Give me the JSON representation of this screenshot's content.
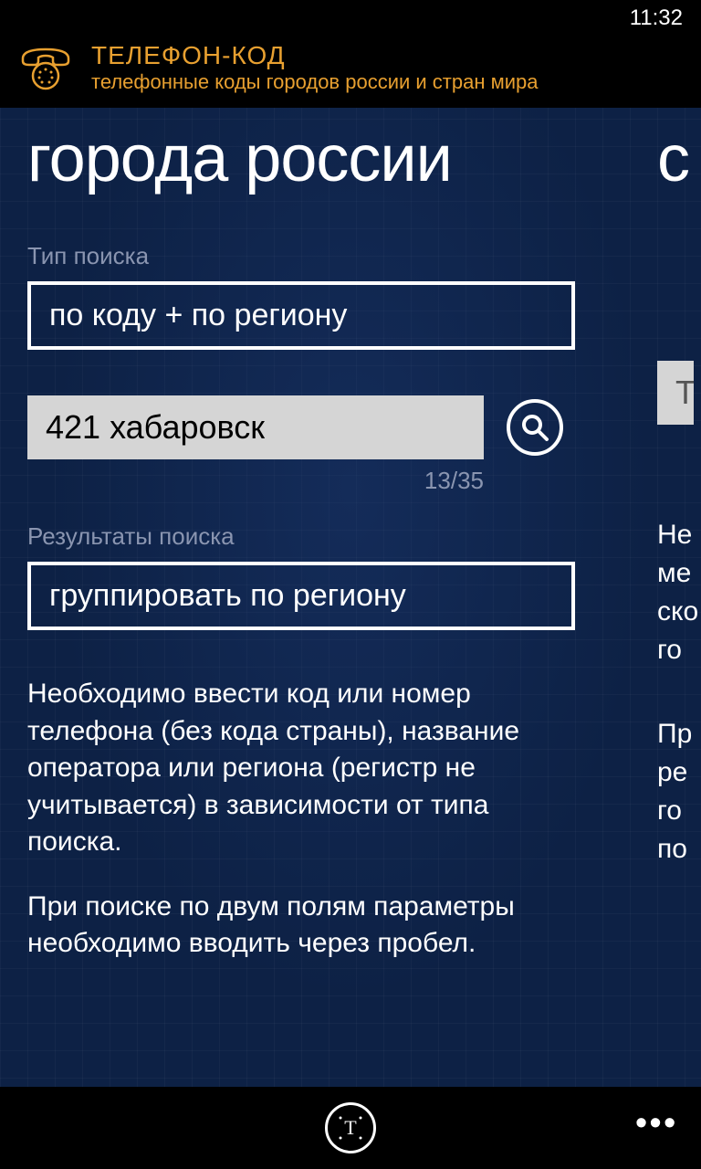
{
  "status": {
    "time": "11:32"
  },
  "header": {
    "title": "ТЕЛЕФОН-КОД",
    "subtitle": "телефонные коды городов россии и стран мира"
  },
  "page1": {
    "title": "города россии",
    "search_type_label": "Тип поиска",
    "search_type_value": "по коду + по региону",
    "search_value": "421 хабаровск",
    "counter": "13/35",
    "results_label": "Результаты поиска",
    "results_value": "группировать по региону",
    "help1": "Необходимо ввести код или номер телефона (без кода страны), название оператора или региона (регистр не учитывается) в зависимости от типа поиска.",
    "help2": "При поиске по двум полям параметры необходимо вводить через пробел."
  },
  "page2": {
    "title_partial": "с",
    "input_partial": "Те",
    "text1_l1": "Не",
    "text1_l2": "ме",
    "text1_l3": "ско",
    "text1_l4": "го",
    "text2_l1": "Пр",
    "text2_l2": "ре",
    "text2_l3": "го",
    "text2_l4": "по"
  },
  "appbar": {
    "button_label": "T",
    "more": "•••"
  }
}
